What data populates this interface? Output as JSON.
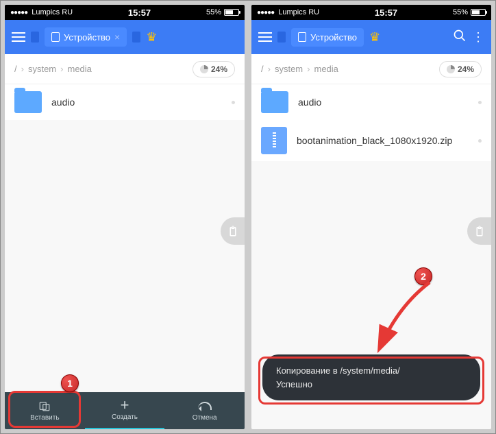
{
  "statusbar": {
    "carrier": "Lumpics RU",
    "time": "15:57",
    "battery_pct": "55%"
  },
  "appbar": {
    "tab_label": "Устройство"
  },
  "breadcrumb": {
    "seg1": "system",
    "seg2": "media",
    "storage": "24%"
  },
  "left": {
    "files": [
      {
        "name": "audio",
        "type": "folder"
      }
    ],
    "bottombar": {
      "paste": "Вставить",
      "create": "Создать",
      "cancel": "Отмена"
    }
  },
  "right": {
    "files": [
      {
        "name": "audio",
        "type": "folder"
      },
      {
        "name": "bootanimation_black_1080x1920.zip",
        "type": "zip"
      }
    ],
    "toast": {
      "line1": "Копирование в /system/media/",
      "line2": "Успешно"
    }
  },
  "markers": {
    "m1": "1",
    "m2": "2"
  }
}
